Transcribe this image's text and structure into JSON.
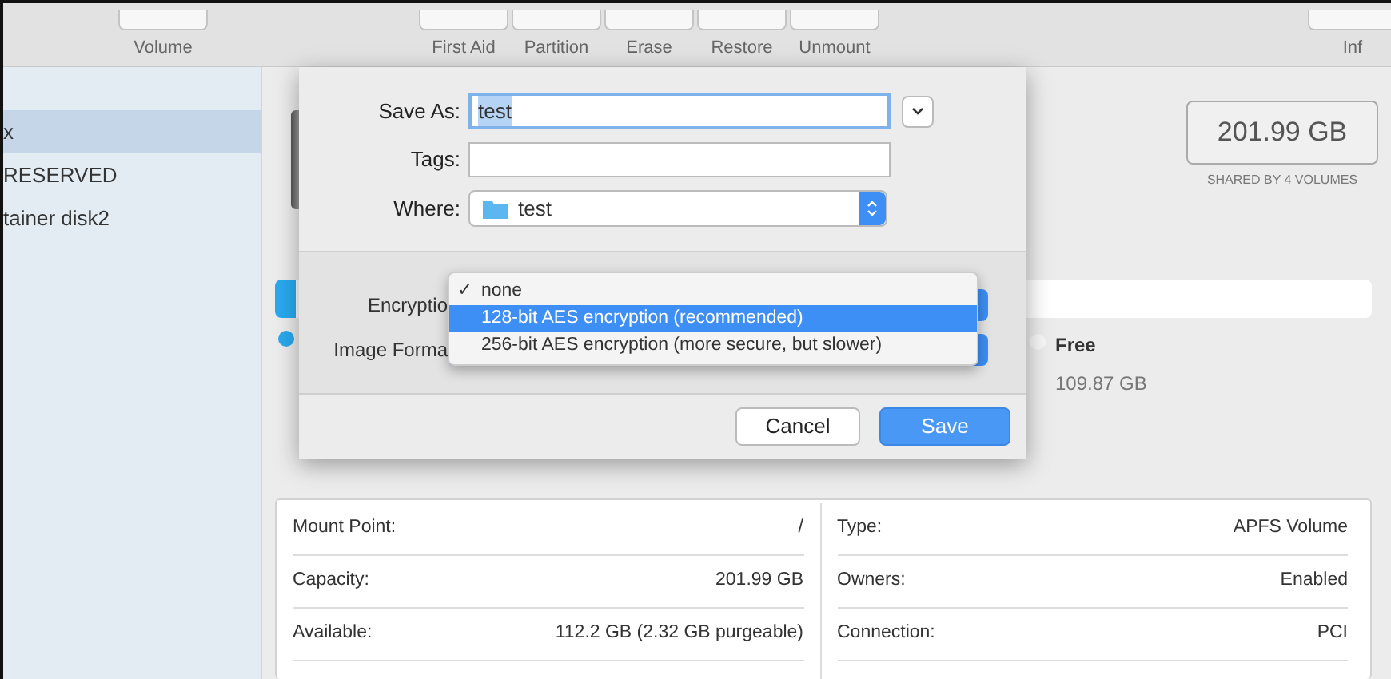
{
  "toolbar": {
    "left": [
      {
        "label": "Volume"
      }
    ],
    "center": [
      {
        "label": "First Aid"
      },
      {
        "label": "Partition"
      },
      {
        "label": "Erase"
      },
      {
        "label": "Restore"
      },
      {
        "label": "Unmount"
      }
    ],
    "right": [
      {
        "label": "Inf"
      }
    ]
  },
  "sidebar": {
    "items": [
      {
        "label": "x",
        "selected": true
      },
      {
        "label": "RESERVED",
        "selected": false
      },
      {
        "label": "tainer disk2",
        "selected": false
      }
    ]
  },
  "volume": {
    "capacity": "201.99 GB",
    "shared": "SHARED BY 4 VOLUMES"
  },
  "usage": {
    "legend": [
      {
        "color": "#2aa9ef"
      },
      {
        "label": "Free",
        "value": "109.87 GB",
        "color": "#f7f7f7"
      }
    ]
  },
  "save_dialog": {
    "save_as": {
      "label": "Save As:",
      "value": "test"
    },
    "tags": {
      "label": "Tags:"
    },
    "where": {
      "label": "Where:",
      "value": "test"
    },
    "options": [
      {
        "label": "Encryptio"
      },
      {
        "label": "Image Forma"
      }
    ],
    "menu": [
      {
        "label": "none",
        "checked": true,
        "selected": false
      },
      {
        "label": "128-bit AES encryption (recommended)",
        "checked": false,
        "selected": true
      },
      {
        "label": "256-bit AES encryption (more secure, but slower)",
        "checked": false,
        "selected": false
      }
    ],
    "check_mark": "✓",
    "buttons": [
      {
        "label": "Cancel",
        "kind": "normal"
      },
      {
        "label": "Save",
        "kind": "default"
      }
    ]
  },
  "info": {
    "left": [
      {
        "label": "Mount Point:",
        "value": "/"
      },
      {
        "label": "Capacity:",
        "value": "201.99 GB"
      },
      {
        "label": "Available:",
        "value": "112.2 GB (2.32 GB purgeable)"
      }
    ],
    "right": [
      {
        "label": "Type:",
        "value": "APFS Volume"
      },
      {
        "label": "Owners:",
        "value": "Enabled"
      },
      {
        "label": "Connection:",
        "value": "PCI"
      }
    ]
  }
}
